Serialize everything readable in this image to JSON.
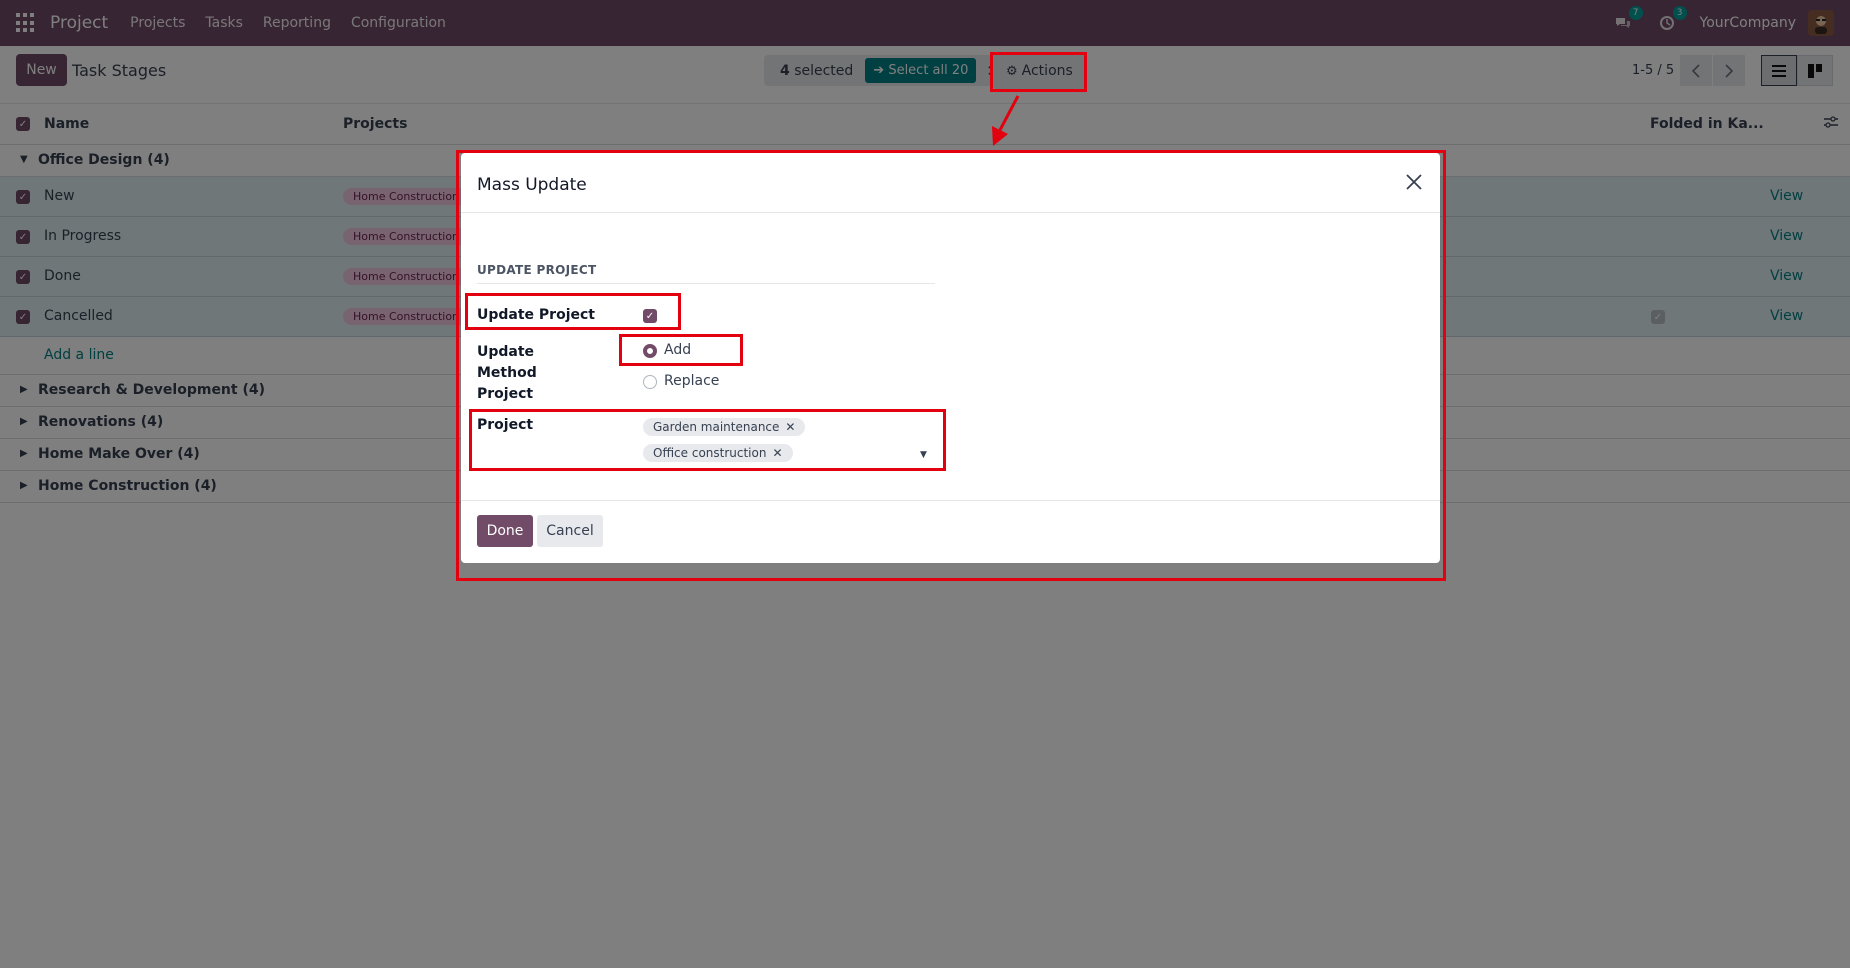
{
  "navbar": {
    "app_name": "Project",
    "menu": [
      "Projects",
      "Tasks",
      "Reporting",
      "Configuration"
    ],
    "chat_count": "7",
    "activity_count": "3",
    "company": "YourCompany"
  },
  "control": {
    "new_label": "New",
    "title": "Task Stages",
    "selected_count": "4",
    "selected_suffix": " selected",
    "select_all_label": "➔ Select all 20",
    "actions_label": "Actions",
    "pager": "1-5 / 5"
  },
  "list": {
    "columns": {
      "name": "Name",
      "projects": "Projects",
      "folded": "Folded in Ka..."
    },
    "groups": [
      "Office Design (4)",
      "Research & Development (4)",
      "Renovations (4)",
      "Home Make Over (4)",
      "Home Construction (4)"
    ],
    "rows": [
      {
        "name": "New",
        "project": "Home Construction",
        "view": "View"
      },
      {
        "name": "In Progress",
        "project": "Home Construction",
        "view": "View"
      },
      {
        "name": "Done",
        "project": "Home Construction",
        "view": "View"
      },
      {
        "name": "Cancelled",
        "project": "Home Construction",
        "view": "View"
      }
    ],
    "add_line": "Add a line"
  },
  "modal": {
    "title": "Mass Update",
    "section": "UPDATE PROJECT",
    "update_label": "Update Project",
    "method_label": "Update Method Project",
    "method_options": [
      "Add",
      "Replace"
    ],
    "method_selected": "Add",
    "project_label": "Project",
    "project_tags": [
      "Garden maintenance",
      "Office construction"
    ],
    "done_label": "Done",
    "cancel_label": "Cancel"
  },
  "colors": {
    "brand": "#714b67",
    "teal": "#017e84",
    "highlight": "#e3000f"
  }
}
